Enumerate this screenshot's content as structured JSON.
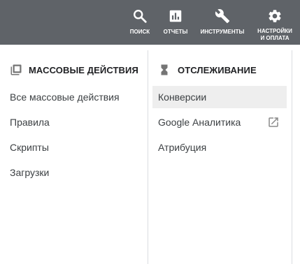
{
  "toolbar": {
    "search": {
      "label": "ПОИСК",
      "icon": "search-icon"
    },
    "reports": {
      "label": "ОТЧЕТЫ",
      "icon": "bar-chart-icon"
    },
    "tools": {
      "label": "ИНСТРУМЕНТЫ",
      "icon": "wrench-icon"
    },
    "settings": {
      "label_line1": "НАСТРОЙКИ",
      "label_line2": "И ОПЛАТА",
      "icon": "gear-icon"
    }
  },
  "bulk_actions": {
    "title": "МАССОВЫЕ ДЕЙСТВИЯ",
    "icon": "copy-stack-icon",
    "items": [
      {
        "label": "Все массовые действия"
      },
      {
        "label": "Правила"
      },
      {
        "label": "Скрипты"
      },
      {
        "label": "Загрузки"
      }
    ]
  },
  "tracking": {
    "title": "ОТСЛЕЖИВАНИЕ",
    "icon": "hourglass-icon",
    "items": [
      {
        "label": "Конверсии",
        "active": true
      },
      {
        "label": "Google Аналитика",
        "external_icon": "external-link-icon"
      },
      {
        "label": "Атрибуция"
      }
    ]
  },
  "colors": {
    "topbar_bg": "#5f6368",
    "active_item_bg": "#eeeeee",
    "divider": "#dadce0",
    "icon_gray": "#757575"
  }
}
